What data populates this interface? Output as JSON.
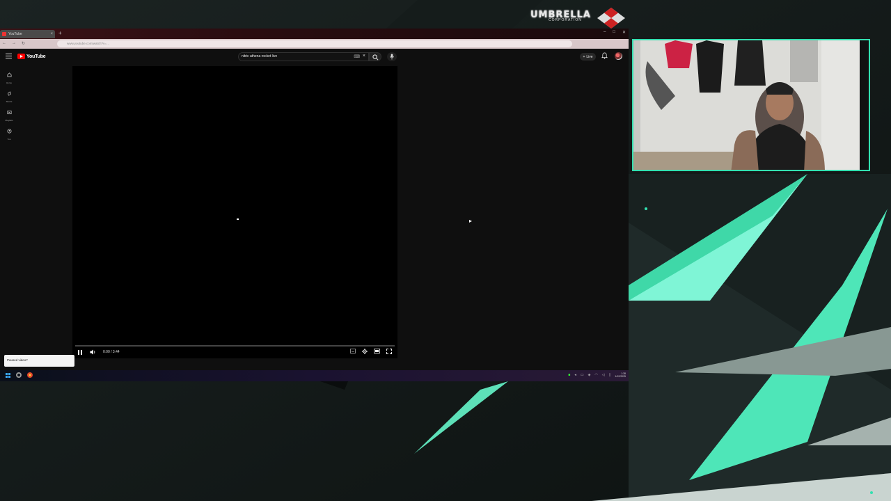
{
  "colors": {
    "accent_teal": "#33e0b0",
    "youtube_red": "#ff0000",
    "background": "#0f1414"
  },
  "overlay": {
    "brand_text": "UMBRELLA",
    "brand_subtext": "CORPORATION"
  },
  "browser": {
    "tab_title": "YouTube",
    "new_tab_label": "+",
    "url": "www.youtube.com/watch?v=…",
    "window_controls": [
      "–",
      "□",
      "✕"
    ]
  },
  "youtube": {
    "logo_text": "YouTube",
    "search_query": "nitric athena rocket live",
    "create_label": "Live",
    "guide": [
      {
        "label": "Home",
        "icon": "home-icon"
      },
      {
        "label": "Shorts",
        "icon": "shorts-icon"
      },
      {
        "label": "Playlists",
        "icon": "playlist-icon"
      },
      {
        "label": "You",
        "icon": "you-icon"
      }
    ],
    "player": {
      "time": "0:00 / 3:44",
      "progress": 0
    },
    "toast": "Paused video?"
  },
  "taskbar": {
    "clock_time": "1:38",
    "clock_date": "1/12/2025"
  }
}
